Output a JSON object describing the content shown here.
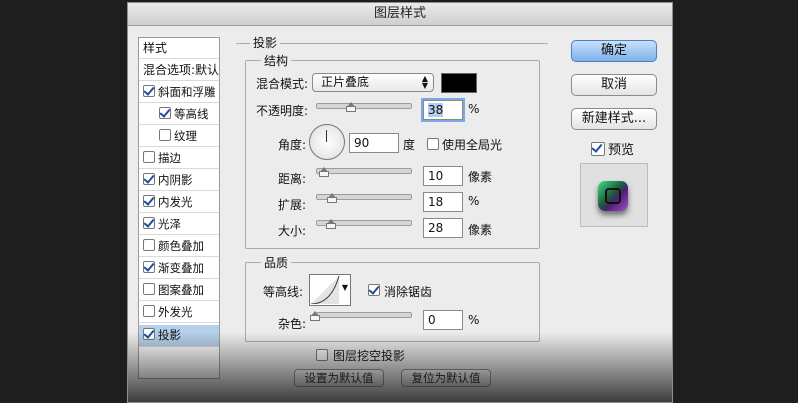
{
  "dialog": {
    "title": "图层样式"
  },
  "style_list": {
    "header": "样式",
    "blend_options": "混合选项:默认",
    "items": [
      {
        "label": "斜面和浮雕",
        "checked": true
      },
      {
        "label": "等高线",
        "checked": true
      },
      {
        "label": "纹理",
        "checked": false
      },
      {
        "label": "描边",
        "checked": false
      },
      {
        "label": "内阴影",
        "checked": true
      },
      {
        "label": "内发光",
        "checked": true
      },
      {
        "label": "光泽",
        "checked": true
      },
      {
        "label": "颜色叠加",
        "checked": false
      },
      {
        "label": "渐变叠加",
        "checked": true
      },
      {
        "label": "图案叠加",
        "checked": false
      },
      {
        "label": "外发光",
        "checked": false
      },
      {
        "label": "投影",
        "checked": true,
        "selected": true
      }
    ]
  },
  "drop_shadow": {
    "section_title": "投影",
    "structure": {
      "title": "结构",
      "blend_mode_label": "混合模式:",
      "blend_mode_value": "正片叠底",
      "color": "#000000",
      "opacity_label": "不透明度:",
      "opacity_value": "38",
      "opacity_unit": "%",
      "angle_label": "角度:",
      "angle_value": "90",
      "angle_unit": "度",
      "global_light_label": "使用全局光",
      "global_light_checked": false,
      "distance_label": "距离:",
      "distance_value": "10",
      "distance_unit": "像素",
      "spread_label": "扩展:",
      "spread_value": "18",
      "spread_unit": "%",
      "size_label": "大小:",
      "size_value": "28",
      "size_unit": "像素"
    },
    "quality": {
      "title": "品质",
      "contour_label": "等高线:",
      "anti_alias_label": "消除锯齿",
      "anti_alias_checked": true,
      "noise_label": "杂色:",
      "noise_value": "0",
      "noise_unit": "%"
    },
    "knockout_label": "图层挖空投影",
    "knockout_checked": false,
    "set_default": "设置为默认值",
    "reset_default": "复位为默认值"
  },
  "buttons": {
    "ok": "确定",
    "cancel": "取消",
    "new_style": "新建样式...",
    "preview_label": "预览",
    "preview_checked": true
  }
}
